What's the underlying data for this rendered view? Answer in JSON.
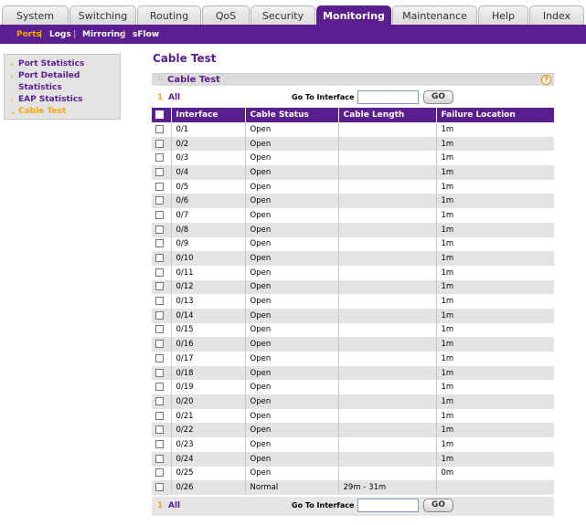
{
  "top_tabs": [
    {
      "label": "System",
      "active": false
    },
    {
      "label": "Switching",
      "active": false
    },
    {
      "label": "Routing",
      "active": false
    },
    {
      "label": "QoS",
      "active": false
    },
    {
      "label": "Security",
      "active": false
    },
    {
      "label": "Monitoring",
      "active": true
    },
    {
      "label": "Maintenance",
      "active": false
    },
    {
      "label": "Help",
      "active": false
    },
    {
      "label": "Index",
      "active": false
    }
  ],
  "sub_tabs": [
    {
      "label": "Ports",
      "active": true
    },
    {
      "label": "Logs",
      "active": false
    },
    {
      "label": "Mirroring",
      "active": false
    },
    {
      "label": "sFlow",
      "active": false
    }
  ],
  "sidebar": [
    {
      "label": "Port Statistics",
      "active": false
    },
    {
      "label": "Port Detailed Statistics",
      "active": false
    },
    {
      "label": "EAP Statistics",
      "active": false
    },
    {
      "label": "Cable Test",
      "active": true
    }
  ],
  "page_title": "Cable Test",
  "section_title": "Cable Test",
  "pagination": {
    "page": "1",
    "all_label": "All"
  },
  "goto": {
    "label": "Go To Interface",
    "value": "",
    "button": "GO"
  },
  "table": {
    "columns": [
      "Interface",
      "Cable Status",
      "Cable Length",
      "Failure Location"
    ],
    "rows": [
      {
        "interface": "0/1",
        "status": "Open",
        "length": "",
        "failure": "1m"
      },
      {
        "interface": "0/2",
        "status": "Open",
        "length": "",
        "failure": "1m"
      },
      {
        "interface": "0/3",
        "status": "Open",
        "length": "",
        "failure": "1m"
      },
      {
        "interface": "0/4",
        "status": "Open",
        "length": "",
        "failure": "1m"
      },
      {
        "interface": "0/5",
        "status": "Open",
        "length": "",
        "failure": "1m"
      },
      {
        "interface": "0/6",
        "status": "Open",
        "length": "",
        "failure": "1m"
      },
      {
        "interface": "0/7",
        "status": "Open",
        "length": "",
        "failure": "1m"
      },
      {
        "interface": "0/8",
        "status": "Open",
        "length": "",
        "failure": "1m"
      },
      {
        "interface": "0/9",
        "status": "Open",
        "length": "",
        "failure": "1m"
      },
      {
        "interface": "0/10",
        "status": "Open",
        "length": "",
        "failure": "1m"
      },
      {
        "interface": "0/11",
        "status": "Open",
        "length": "",
        "failure": "1m"
      },
      {
        "interface": "0/12",
        "status": "Open",
        "length": "",
        "failure": "1m"
      },
      {
        "interface": "0/13",
        "status": "Open",
        "length": "",
        "failure": "1m"
      },
      {
        "interface": "0/14",
        "status": "Open",
        "length": "",
        "failure": "1m"
      },
      {
        "interface": "0/15",
        "status": "Open",
        "length": "",
        "failure": "1m"
      },
      {
        "interface": "0/16",
        "status": "Open",
        "length": "",
        "failure": "1m"
      },
      {
        "interface": "0/17",
        "status": "Open",
        "length": "",
        "failure": "1m"
      },
      {
        "interface": "0/18",
        "status": "Open",
        "length": "",
        "failure": "1m"
      },
      {
        "interface": "0/19",
        "status": "Open",
        "length": "",
        "failure": "1m"
      },
      {
        "interface": "0/20",
        "status": "Open",
        "length": "",
        "failure": "1m"
      },
      {
        "interface": "0/21",
        "status": "Open",
        "length": "",
        "failure": "1m"
      },
      {
        "interface": "0/22",
        "status": "Open",
        "length": "",
        "failure": "1m"
      },
      {
        "interface": "0/23",
        "status": "Open",
        "length": "",
        "failure": "1m"
      },
      {
        "interface": "0/24",
        "status": "Open",
        "length": "",
        "failure": "1m"
      },
      {
        "interface": "0/25",
        "status": "Open",
        "length": "",
        "failure": "0m"
      },
      {
        "interface": "0/26",
        "status": "Normal",
        "length": "29m - 31m",
        "failure": ""
      }
    ]
  }
}
